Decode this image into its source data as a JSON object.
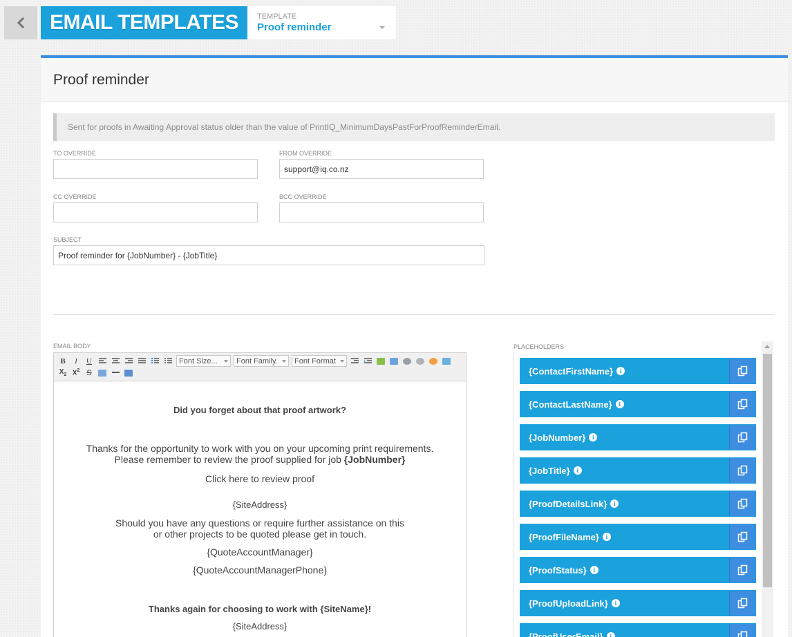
{
  "header": {
    "title": "EMAIL TEMPLATES",
    "template_label": "TEMPLATE",
    "template_value": "Proof reminder"
  },
  "panel": {
    "title": "Proof reminder",
    "note": "Sent for proofs in Awaiting Approval status older than the value of PrintIQ_MinimumDaysPastForProofReminderEmail."
  },
  "form": {
    "to_label": "TO OVERRIDE",
    "to_value": "",
    "from_label": "FROM OVERRIDE",
    "from_value": "support@iq.co.nz",
    "cc_label": "CC OVERRIDE",
    "cc_value": "",
    "bcc_label": "BCC OVERRIDE",
    "bcc_value": "",
    "subject_label": "SUBJECT",
    "subject_value": "Proof reminder for {JobNumber} - {JobTitle}"
  },
  "editor": {
    "label": "EMAIL BODY",
    "toolbar": {
      "font_size": "Font Size...",
      "font_family": "Font Family.",
      "font_format": "Font Format"
    },
    "body": {
      "heading": "Did you forget about that proof artwork?",
      "line1": "Thanks for the opportunity to work with you on your upcoming print requirements.",
      "line2": "Please remember to review the proof supplied for job ",
      "job_number": "{JobNumber}",
      "review_link": "Click here to review proof",
      "site_address_1": "{SiteAddress}",
      "line3": "Should you have any questions or require further assistance on this",
      "line4": "or other projects to be quoted please get in touch.",
      "manager": "{QuoteAccountManager}",
      "manager_phone": "{QuoteAccountManagerPhone}",
      "thanks": "Thanks again for choosing to work with {SiteName}!",
      "site_address_2": "{SiteAddress}"
    }
  },
  "placeholders": {
    "label": "PLACEHOLDERS",
    "items": [
      {
        "label": "{ContactFirstName}"
      },
      {
        "label": "{ContactLastName}"
      },
      {
        "label": "{JobNumber}"
      },
      {
        "label": "{JobTitle}"
      },
      {
        "label": "{ProofDetailsLink}"
      },
      {
        "label": "{ProofFileName}"
      },
      {
        "label": "{ProofStatus}"
      },
      {
        "label": "{ProofUploadLink}"
      },
      {
        "label": "{ProofUserEmail}"
      }
    ]
  },
  "colors": {
    "accent": "#1ba1dc",
    "accent_dark": "#3d8de0"
  }
}
